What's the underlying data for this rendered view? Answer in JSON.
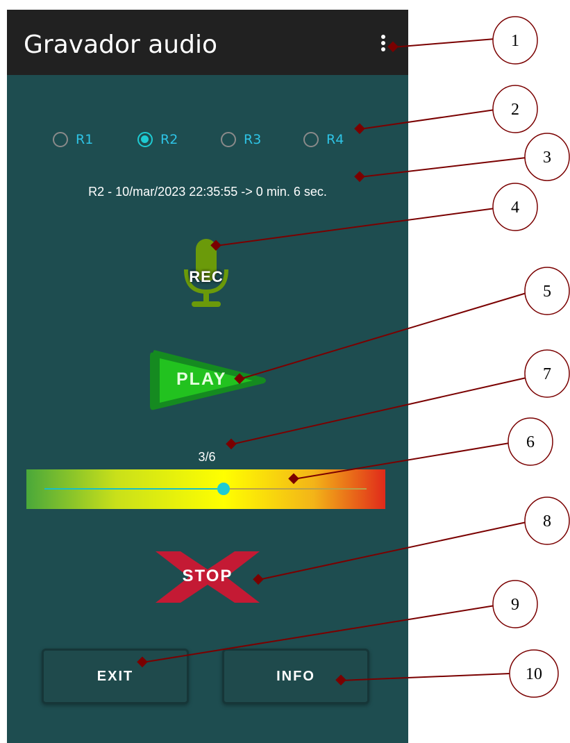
{
  "app": {
    "title": "Gravador audio"
  },
  "radios": [
    {
      "label": "R1",
      "checked": false
    },
    {
      "label": "R2",
      "checked": true
    },
    {
      "label": "R3",
      "checked": false
    },
    {
      "label": "R4",
      "checked": false
    }
  ],
  "recording_info": "R2 - 10/mar/2023 22:35:55 -> 0 min. 6 sec.",
  "buttons": {
    "rec": "REC",
    "play": "PLAY",
    "stop": "STOP",
    "exit": "EXIT",
    "info": "INFO"
  },
  "volume": {
    "label": "3/6",
    "value": 3,
    "max": 6
  },
  "icons": {
    "menu": "more-vert-icon",
    "rec": "microphone-icon",
    "play": "play-triangle-icon",
    "stop": "cross-icon"
  },
  "callouts": [
    "1",
    "2",
    "3",
    "4",
    "5",
    "7",
    "6",
    "8",
    "9",
    "10"
  ],
  "colors": {
    "appbar": "#212121",
    "background": "#1e4d50",
    "accent": "#1ecbd3",
    "radio_label": "#2ec4e6",
    "callout": "#7a0000"
  }
}
